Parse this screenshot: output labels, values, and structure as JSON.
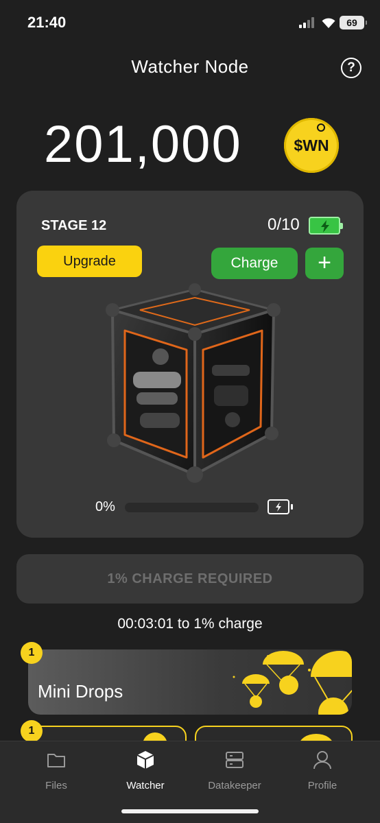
{
  "status_bar": {
    "time": "21:40",
    "battery": "69"
  },
  "header": {
    "title": "Watcher Node",
    "help_icon": "question-circle-icon"
  },
  "balance": {
    "value": "201,000",
    "token": "$WN"
  },
  "node_card": {
    "stage": "STAGE 12",
    "charges": "0/10",
    "upgrade_label": "Upgrade",
    "charge_label": "Charge",
    "plus_label": "+",
    "progress_text": "0%",
    "progress_fraction": 0.0
  },
  "charge_required_label": "1% CHARGE REQUIRED",
  "timer_text": "00:03:01 to 1% charge",
  "mini_drops": {
    "badge": "1",
    "title": "Mini Drops"
  },
  "next_card": {
    "badge": "1"
  },
  "nav": {
    "items": [
      {
        "label": "Files",
        "icon": "folder-icon"
      },
      {
        "label": "Watcher",
        "icon": "cube-icon"
      },
      {
        "label": "Datakeeper",
        "icon": "server-icon"
      },
      {
        "label": "Profile",
        "icon": "user-icon"
      }
    ],
    "active": "Watcher"
  },
  "colors": {
    "background": "#1f1f1f",
    "card": "#383838",
    "yellow": "#fad20f",
    "green": "#34a63c",
    "muted_text": "#6e6e6e"
  }
}
